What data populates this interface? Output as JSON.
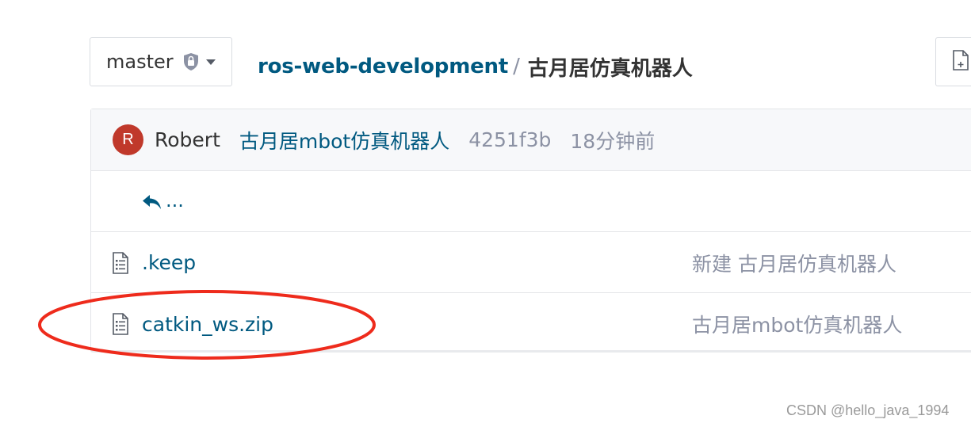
{
  "branch": {
    "name": "master",
    "lock_icon": "lock-shield-icon",
    "caret_icon": "caret-down-icon"
  },
  "breadcrumb": {
    "repo": "ros-web-development",
    "separator": "/",
    "directory": "古月居仿真机器人"
  },
  "toolbar": {
    "new_file_icon": "new-file-icon"
  },
  "commit": {
    "avatar_letter": "R",
    "author": "Robert",
    "message": "古月居mbot仿真机器人",
    "sha": "4251f3b",
    "time": "18分钟前"
  },
  "parent_dir": {
    "icon": "reply-arrow-icon",
    "label": "..."
  },
  "files": [
    {
      "name": ".keep",
      "icon": "file-document-icon",
      "last_commit": "新建 古月居仿真机器人"
    },
    {
      "name": "catkin_ws.zip",
      "icon": "file-document-icon",
      "last_commit": "古月居mbot仿真机器人"
    }
  ],
  "watermark": "CSDN @hello_java_1994",
  "colors": {
    "link": "#005980",
    "muted": "#8c92a4",
    "avatar": "#c0392b",
    "annotation": "#ee2b1c"
  }
}
